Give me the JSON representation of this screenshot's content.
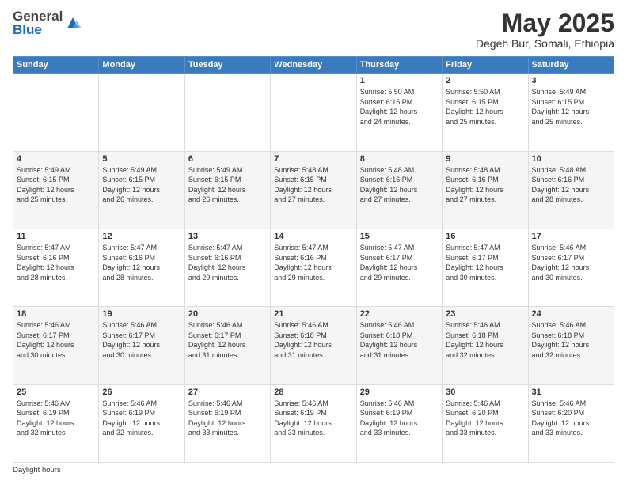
{
  "header": {
    "logo_general": "General",
    "logo_blue": "Blue",
    "title": "May 2025",
    "subtitle": "Degeh Bur, Somali, Ethiopia"
  },
  "days_of_week": [
    "Sunday",
    "Monday",
    "Tuesday",
    "Wednesday",
    "Thursday",
    "Friday",
    "Saturday"
  ],
  "weeks": [
    [
      {
        "day": "",
        "info": ""
      },
      {
        "day": "",
        "info": ""
      },
      {
        "day": "",
        "info": ""
      },
      {
        "day": "",
        "info": ""
      },
      {
        "day": "1",
        "info": "Sunrise: 5:50 AM\nSunset: 6:15 PM\nDaylight: 12 hours\nand 24 minutes."
      },
      {
        "day": "2",
        "info": "Sunrise: 5:50 AM\nSunset: 6:15 PM\nDaylight: 12 hours\nand 25 minutes."
      },
      {
        "day": "3",
        "info": "Sunrise: 5:49 AM\nSunset: 6:15 PM\nDaylight: 12 hours\nand 25 minutes."
      }
    ],
    [
      {
        "day": "4",
        "info": "Sunrise: 5:49 AM\nSunset: 6:15 PM\nDaylight: 12 hours\nand 25 minutes."
      },
      {
        "day": "5",
        "info": "Sunrise: 5:49 AM\nSunset: 6:15 PM\nDaylight: 12 hours\nand 26 minutes."
      },
      {
        "day": "6",
        "info": "Sunrise: 5:49 AM\nSunset: 6:15 PM\nDaylight: 12 hours\nand 26 minutes."
      },
      {
        "day": "7",
        "info": "Sunrise: 5:48 AM\nSunset: 6:15 PM\nDaylight: 12 hours\nand 27 minutes."
      },
      {
        "day": "8",
        "info": "Sunrise: 5:48 AM\nSunset: 6:16 PM\nDaylight: 12 hours\nand 27 minutes."
      },
      {
        "day": "9",
        "info": "Sunrise: 5:48 AM\nSunset: 6:16 PM\nDaylight: 12 hours\nand 27 minutes."
      },
      {
        "day": "10",
        "info": "Sunrise: 5:48 AM\nSunset: 6:16 PM\nDaylight: 12 hours\nand 28 minutes."
      }
    ],
    [
      {
        "day": "11",
        "info": "Sunrise: 5:47 AM\nSunset: 6:16 PM\nDaylight: 12 hours\nand 28 minutes."
      },
      {
        "day": "12",
        "info": "Sunrise: 5:47 AM\nSunset: 6:16 PM\nDaylight: 12 hours\nand 28 minutes."
      },
      {
        "day": "13",
        "info": "Sunrise: 5:47 AM\nSunset: 6:16 PM\nDaylight: 12 hours\nand 29 minutes."
      },
      {
        "day": "14",
        "info": "Sunrise: 5:47 AM\nSunset: 6:16 PM\nDaylight: 12 hours\nand 29 minutes."
      },
      {
        "day": "15",
        "info": "Sunrise: 5:47 AM\nSunset: 6:17 PM\nDaylight: 12 hours\nand 29 minutes."
      },
      {
        "day": "16",
        "info": "Sunrise: 5:47 AM\nSunset: 6:17 PM\nDaylight: 12 hours\nand 30 minutes."
      },
      {
        "day": "17",
        "info": "Sunrise: 5:46 AM\nSunset: 6:17 PM\nDaylight: 12 hours\nand 30 minutes."
      }
    ],
    [
      {
        "day": "18",
        "info": "Sunrise: 5:46 AM\nSunset: 6:17 PM\nDaylight: 12 hours\nand 30 minutes."
      },
      {
        "day": "19",
        "info": "Sunrise: 5:46 AM\nSunset: 6:17 PM\nDaylight: 12 hours\nand 30 minutes."
      },
      {
        "day": "20",
        "info": "Sunrise: 5:46 AM\nSunset: 6:17 PM\nDaylight: 12 hours\nand 31 minutes."
      },
      {
        "day": "21",
        "info": "Sunrise: 5:46 AM\nSunset: 6:18 PM\nDaylight: 12 hours\nand 31 minutes."
      },
      {
        "day": "22",
        "info": "Sunrise: 5:46 AM\nSunset: 6:18 PM\nDaylight: 12 hours\nand 31 minutes."
      },
      {
        "day": "23",
        "info": "Sunrise: 5:46 AM\nSunset: 6:18 PM\nDaylight: 12 hours\nand 32 minutes."
      },
      {
        "day": "24",
        "info": "Sunrise: 5:46 AM\nSunset: 6:18 PM\nDaylight: 12 hours\nand 32 minutes."
      }
    ],
    [
      {
        "day": "25",
        "info": "Sunrise: 5:46 AM\nSunset: 6:19 PM\nDaylight: 12 hours\nand 32 minutes."
      },
      {
        "day": "26",
        "info": "Sunrise: 5:46 AM\nSunset: 6:19 PM\nDaylight: 12 hours\nand 32 minutes."
      },
      {
        "day": "27",
        "info": "Sunrise: 5:46 AM\nSunset: 6:19 PM\nDaylight: 12 hours\nand 33 minutes."
      },
      {
        "day": "28",
        "info": "Sunrise: 5:46 AM\nSunset: 6:19 PM\nDaylight: 12 hours\nand 33 minutes."
      },
      {
        "day": "29",
        "info": "Sunrise: 5:46 AM\nSunset: 6:19 PM\nDaylight: 12 hours\nand 33 minutes."
      },
      {
        "day": "30",
        "info": "Sunrise: 5:46 AM\nSunset: 6:20 PM\nDaylight: 12 hours\nand 33 minutes."
      },
      {
        "day": "31",
        "info": "Sunrise: 5:46 AM\nSunset: 6:20 PM\nDaylight: 12 hours\nand 33 minutes."
      }
    ]
  ],
  "footer": {
    "daylight_hours": "Daylight hours"
  }
}
